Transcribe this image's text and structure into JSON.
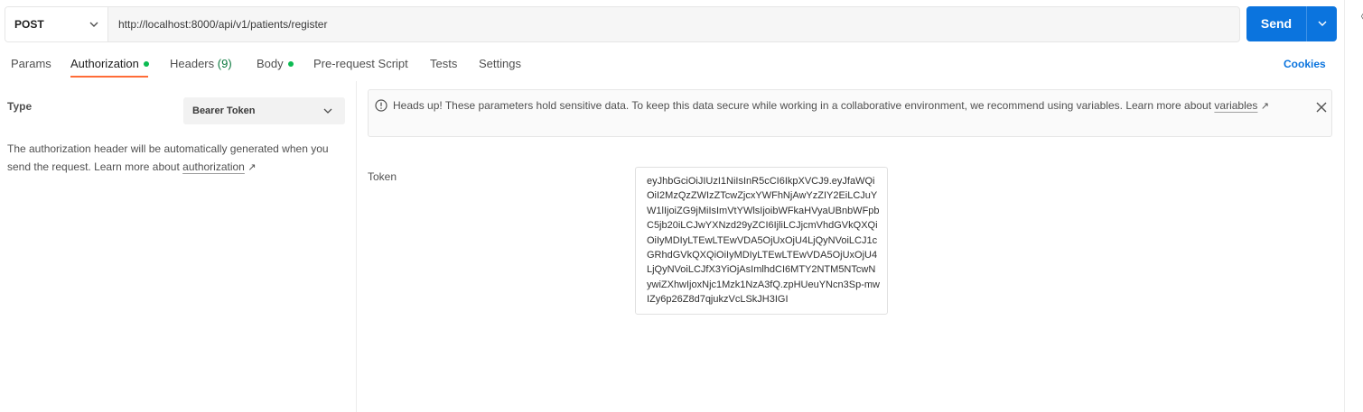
{
  "request": {
    "method": "POST",
    "url": "http://localhost:8000/api/v1/patients/register",
    "send_label": "Send"
  },
  "tabs": [
    {
      "label": "Params"
    },
    {
      "label": "Authorization"
    },
    {
      "label": "Headers",
      "count": "(9)"
    },
    {
      "label": "Body"
    },
    {
      "label": "Pre-request Script"
    },
    {
      "label": "Tests"
    },
    {
      "label": "Settings"
    }
  ],
  "cookies_label": "Cookies",
  "auth": {
    "type_label": "Type",
    "type_value": "Bearer Token",
    "description": "The authorization header will be automatically generated when you send the request. Learn more about",
    "description_link": "authorization",
    "link_arrow": "↗"
  },
  "alert": {
    "text": "Heads up! These parameters hold sensitive data. To keep this data secure while working in a collaborative environment, we recommend using variables. Learn more about",
    "link": "variables",
    "link_arrow": "↗"
  },
  "token": {
    "label": "Token",
    "value": "eyJhbGciOiJIUzI1NiIsInR5cCI6IkpXVCJ9.eyJfaWQiOiI2MzQzZWIzZTcwZjcxYWFhNjAwYzZIY2EiLCJuYW1lIjoiZG9jMiIsImVtYWlsIjoibWFkaHVyaUBnbWFpbC5jb20iLCJwYXNzd29yZCI6IjliLCJjcmVhdGVkQXQiOiIyMDIyLTEwLTEwVDA5OjUxOjU4LjQyNVoiLCJ1cGRhdGVkQXQiOiIyMDIyLTEwLTEwVDA5OjUxOjU4LjQyNVoiLCJfX3YiOjAsImlhdCI6MTY2NTM5NTcwNywiZXhwIjoxNjc1Mzk1NzA3fQ.zpHUeuYNcn3Sp-mwIZy6p26Z8d7qjukzVcLSkJH3IGI"
  },
  "colors": {
    "accent": "#0b74de",
    "active_tab_underline": "#ff6c37",
    "status_dot": "#0cbb52"
  },
  "icons": {
    "method_dropdown": "chevron-down-icon",
    "send_dropdown": "chevron-down-icon",
    "alert": "info-icon",
    "alert_close": "close-icon"
  }
}
